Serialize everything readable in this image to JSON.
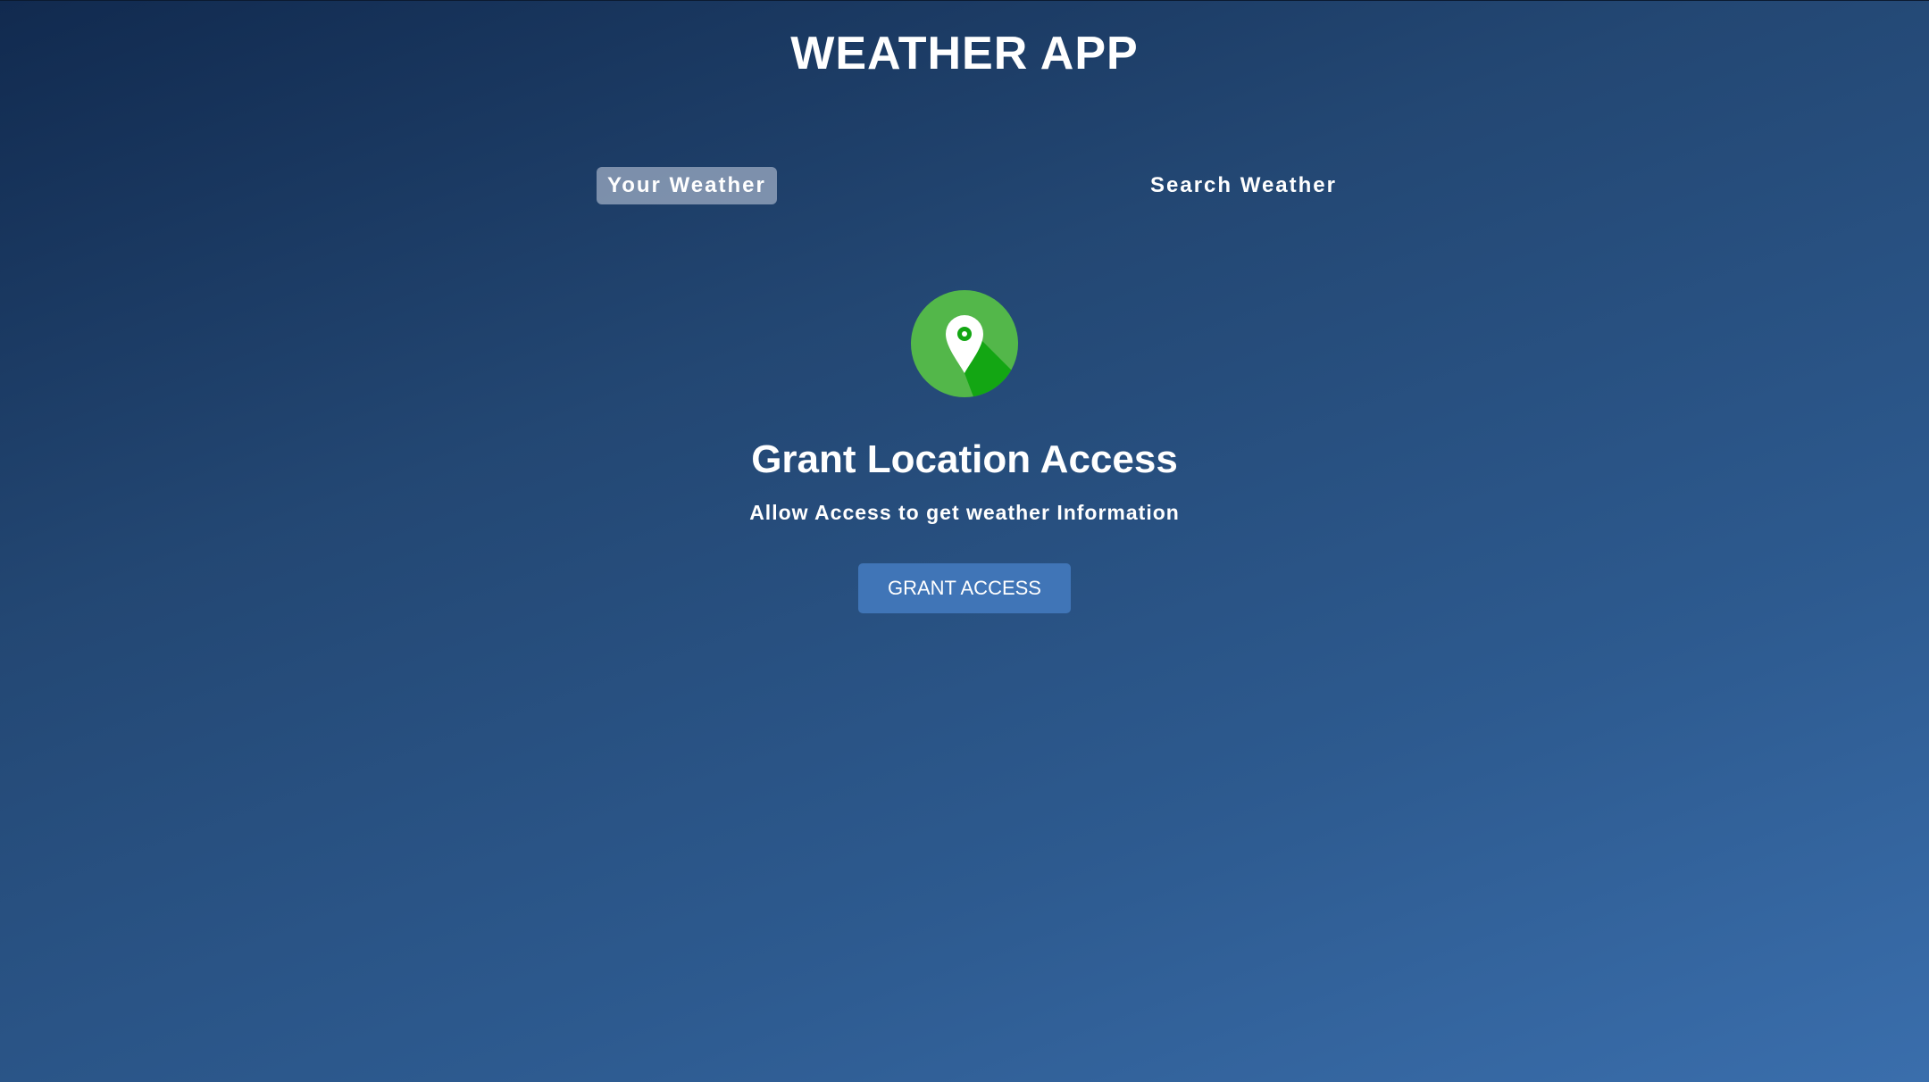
{
  "app": {
    "title": "WEATHER APP"
  },
  "tabs": [
    {
      "label": "Your Weather",
      "active": true
    },
    {
      "label": "Search Weather",
      "active": false
    }
  ],
  "grant": {
    "icon": "location-pin-icon",
    "title": "Grant Location Access",
    "subtitle": "Allow Access to get weather Information",
    "button_label": "GRANT ACCESS"
  },
  "colors": {
    "background_start": "#112a4f",
    "background_end": "#3a6eac",
    "icon_green": "#53b74a",
    "icon_shadow": "#13a613",
    "button": "#4075b7"
  }
}
